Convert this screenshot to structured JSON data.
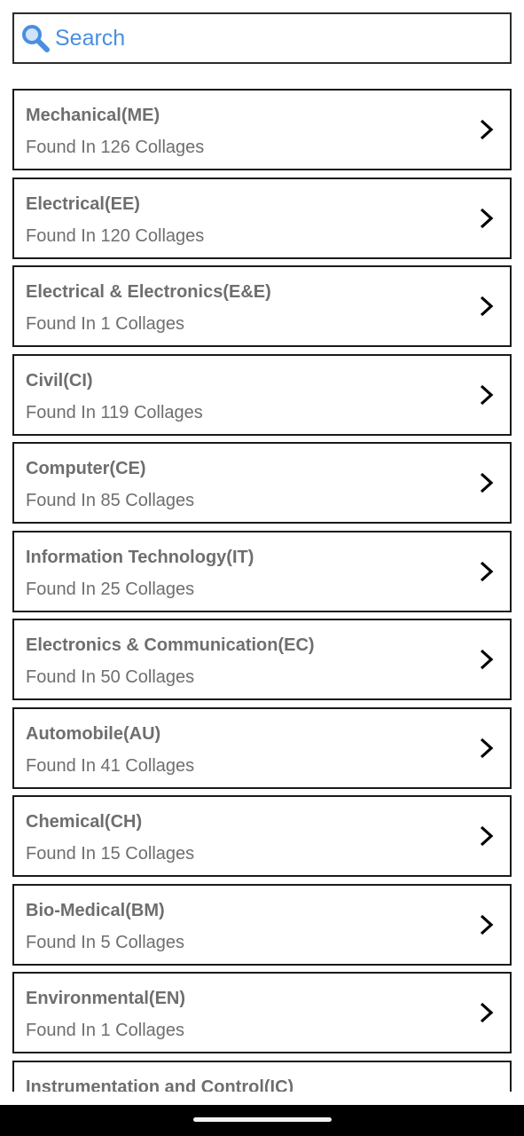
{
  "search": {
    "placeholder": "Search",
    "icon": "magnifier-icon"
  },
  "branches": [
    {
      "name": "Mechanical(ME)",
      "count_text": "Found In 126 Collages"
    },
    {
      "name": "Electrical(EE)",
      "count_text": "Found In 120 Collages"
    },
    {
      "name": "Electrical & Electronics(E&E)",
      "count_text": "Found In 1 Collages"
    },
    {
      "name": "Civil(CI)",
      "count_text": "Found In 119 Collages"
    },
    {
      "name": "Computer(CE)",
      "count_text": "Found In 85 Collages"
    },
    {
      "name": "Information Technology(IT)",
      "count_text": "Found In 25 Collages"
    },
    {
      "name": "Electronics & Communication(EC)",
      "count_text": "Found In 50 Collages"
    },
    {
      "name": "Automobile(AU)",
      "count_text": "Found In 41 Collages"
    },
    {
      "name": "Chemical(CH)",
      "count_text": "Found In 15 Collages"
    },
    {
      "name": "Bio-Medical(BM)",
      "count_text": "Found In 5 Collages"
    },
    {
      "name": "Environmental(EN)",
      "count_text": "Found In 1 Collages"
    },
    {
      "name": "Instrumentation and Control(IC)",
      "count_text": ""
    }
  ],
  "colors": {
    "accent": "#3a86e0",
    "text_gray": "#6e6e6e",
    "border": "#1a1a1a"
  }
}
